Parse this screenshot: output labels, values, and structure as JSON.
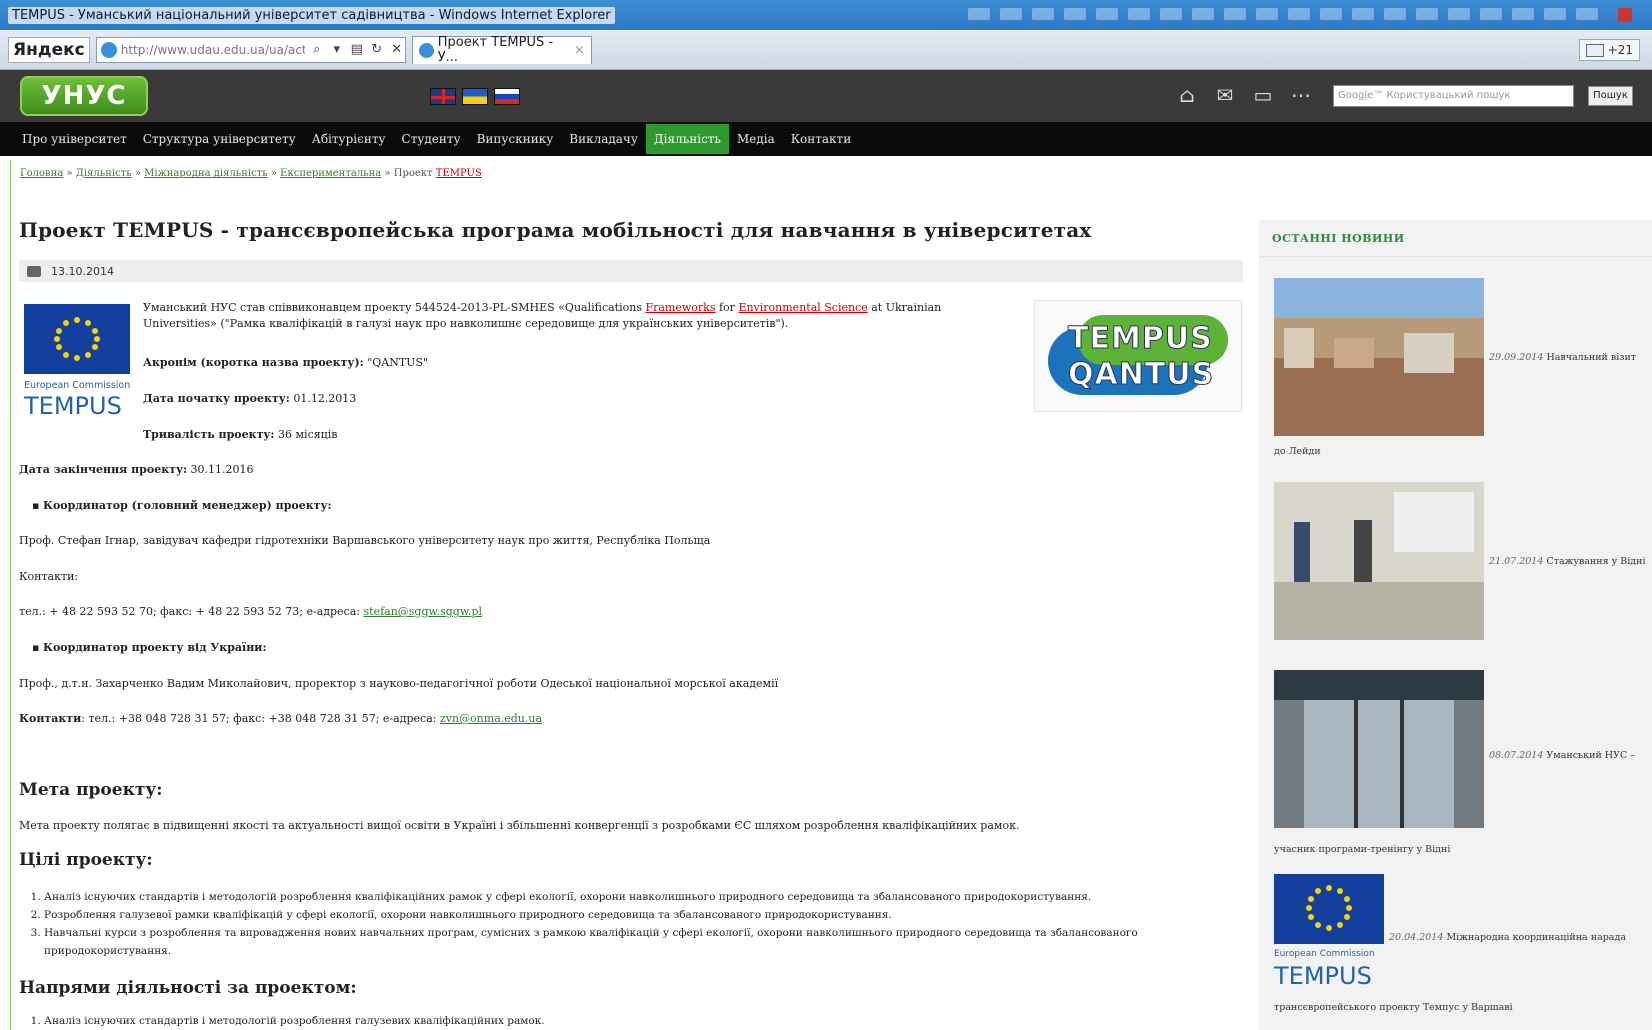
{
  "window": {
    "title": "TEMPUS - Уманський національний університет садівництва - Windows Internet Explorer"
  },
  "browser": {
    "yandex_label": "Яндекс",
    "url": "http://www.udau.edu.ua/ua/activities/mizhn",
    "tab_label": "Проект TEMPUS - У...",
    "tab_close": "×",
    "right_count": "+21"
  },
  "site": {
    "logo": "УНУС",
    "search_placeholder": "Google™ Користувацький пошук",
    "search_button": "Пошук"
  },
  "nav": [
    {
      "label": "Про університет"
    },
    {
      "label": "Структура університету"
    },
    {
      "label": "Абітурієнту"
    },
    {
      "label": "Студенту"
    },
    {
      "label": "Випускнику"
    },
    {
      "label": "Викладачу"
    },
    {
      "label": "Діяльність"
    },
    {
      "label": "Медіа"
    },
    {
      "label": "Контакти"
    }
  ],
  "breadcrumb": {
    "items": [
      "Головна",
      "Діяльність",
      "Міжнародна діяльність",
      "Експериментальна"
    ],
    "sep": " » ",
    "last_prefix": "Проект ",
    "last": "TEMPUS"
  },
  "article": {
    "title": "Проект TEMPUS - трансєвропейська програма мобільності для навчання в університетах",
    "date": "13.10.2014",
    "intro_1": "Уманський НУС став співвиконавцем проекту 544524-2013-PL-SMHES «Qualifications ",
    "intro_link_1": "Frameworks",
    "intro_2": " for ",
    "intro_link_2": "Environmental Science",
    "intro_3": " at Ukrainian",
    "intro_4": "Universities» (\"Рамка кваліфікацій в галузі наук про навколишнє середовище для українських університетів\").",
    "acronym_label": "Акронім (коротка назва проекту):",
    "acronym_value": " \"QANTUS\"",
    "start_label": "Дата початку проекту:",
    "start_value": " 01.12.2013",
    "duration_label": "Тривалість проекту:",
    "duration_value": " 36 місяців",
    "end_label": "Дата закінчення проекту:",
    "end_value": " 30.11.2016",
    "coord_label": "Координатор (головний менеджер) проекту:",
    "coord_text": "Проф. Стефан Ігнар, завідувач кафедри гідротехніки Варшавського університету наук про життя, Республіка Польща",
    "contacts_label": "Контакти:",
    "coord_contacts": "тел.: + 48 22 593 52 70; факс: + 48 22 593 52 73; е-адреса: ",
    "coord_email": "stefan@sggw.sggw.pl",
    "ua_coord_label": "Координатор проекту від України:",
    "ua_coord_text": "Проф., д.т.н. Захарченко Вадим Миколайович, проректор з науково-педагогічної роботи Одеської національної морської академії",
    "ua_contacts_label": "Контакти",
    "ua_contacts": ": тел.: +38 048 728 31 57; факс: +38 048 728 31 57; е-адреса: ",
    "ua_email": "zvn@onma.edu.ua",
    "goal_heading": "Мета проекту:",
    "goal_text": "Мета проекту полягає в підвищенні якості та актуальності вищої освіти в Україні і збільшенні конвергенції з розробками ЄС шляхом розроблення кваліфікаційних рамок.",
    "aims_heading": "Цілі проекту:",
    "aims": [
      "Аналіз існуючих стандартів і методологій розроблення кваліфікаційних рамок у сфері екології, охорони навколишнього природного середовища та збалансованого природокористування.",
      "Розроблення галузевої рамки кваліфікацій у сфері екології, охорони навколишнього природного середовища та збалансованого природокористування.",
      "Навчальні курси з розроблення та впровадження нових навчальних програм, сумісних з рамкою кваліфікацій у сфері екології, охорони навколишнього природного середовища та збалансованого",
      "природокористування."
    ],
    "dir_heading": "Напрями діяльності за проектом:",
    "dirs": [
      "Аналіз існуючих стандартів і методологій розроблення галузевих кваліфікаційних рамок."
    ]
  },
  "logos": {
    "eu_caption": "European Commission",
    "eu_word": "TEMPUS",
    "tempus": "TEMPUS",
    "qantus": "QANTUS"
  },
  "sidebar": {
    "heading": "ОСТАННІ НОВИНИ",
    "news": [
      {
        "date": "29.09.2014",
        "title": "Навчальний візит",
        "tail": "до Лейди"
      },
      {
        "date": "21.07.2014",
        "title": "Стажування у Відні",
        "tail": ""
      },
      {
        "date": "08.07.2014",
        "title": "Уманський НУС –",
        "tail": "учасник програми-тренінгу у Відні"
      },
      {
        "date": "20.04.2014",
        "title": "Міжнародна координаційна нарада",
        "tail": "трансєвропейського проекту Темпус у Варшаві"
      }
    ]
  }
}
